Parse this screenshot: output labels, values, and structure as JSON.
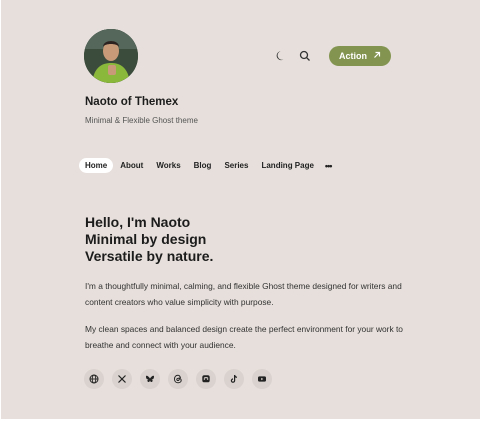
{
  "header": {
    "action_label": "Action",
    "icons": [
      "moon-icon",
      "search-icon",
      "arrow-up-right-icon"
    ]
  },
  "site": {
    "title": "Naoto of Themex",
    "description": "Minimal & Flexible Ghost theme"
  },
  "nav": {
    "items": [
      "Home",
      "About",
      "Works",
      "Blog",
      "Series",
      "Landing Page"
    ],
    "active": "Home",
    "more": "•••"
  },
  "hero": {
    "line1": "Hello, I'm Naoto",
    "line2": "Minimal by design",
    "line3": "Versatile by nature."
  },
  "intro": {
    "p1": "I'm a thoughtfully minimal, calming, and flexible Ghost theme designed for writers and content creators who value simplicity with purpose.",
    "p2": "My clean spaces and balanced design create the perfect environment for your work to breathe and connect with your audience."
  },
  "socials": [
    "globe-icon",
    "x-icon",
    "bluesky-icon",
    "threads-icon",
    "mastodon-icon",
    "tiktok-icon",
    "youtube-icon"
  ],
  "colors": {
    "background": "#e6dfdb",
    "accent": "#829450",
    "active_tab": "#ffffff",
    "social_bg": "#d9d2ce"
  }
}
